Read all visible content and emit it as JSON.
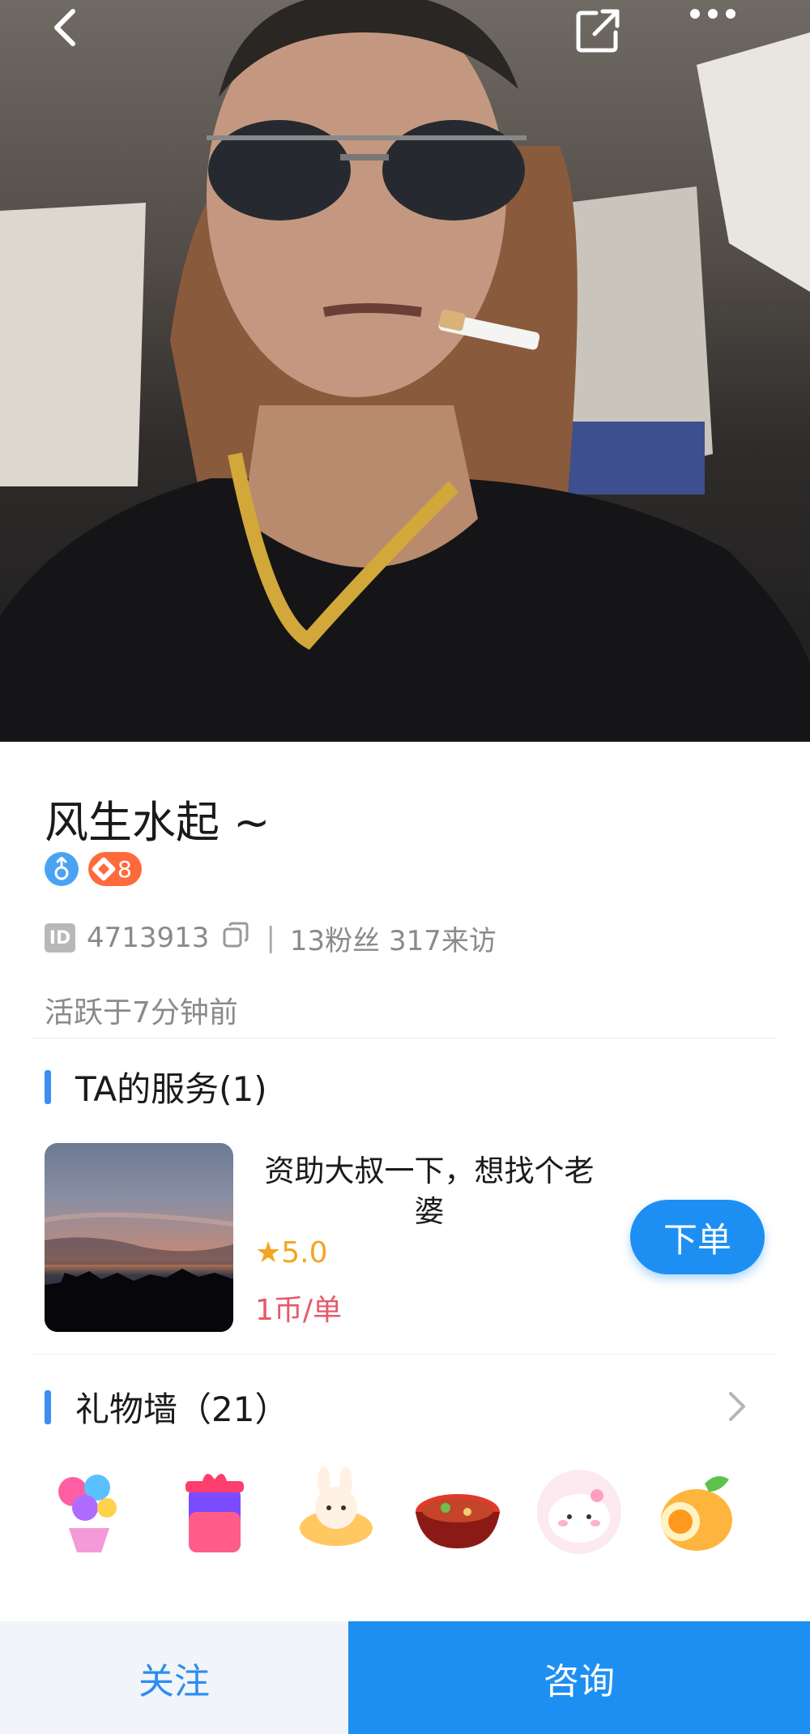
{
  "header": {
    "back_icon": "chevron-left-icon",
    "share_icon": "share-icon",
    "more_icon": "more-dots-icon"
  },
  "profile": {
    "name": "风生水起 ~",
    "gender_icon": "male-icon",
    "level": "8",
    "id_label": "ID",
    "id_value": "4713913",
    "stats": "13粉丝 317来访",
    "separator": "|",
    "active_status": "活跃于7分钟前"
  },
  "services": {
    "title": "TA的服务(1)",
    "items": [
      {
        "title": "资助大叔一下，想找个老婆",
        "rating": "5.0",
        "price": "1币/单",
        "order_label": "下单"
      }
    ]
  },
  "gift_wall": {
    "title": "礼物墙（21）",
    "gifts": [
      "balloon-gift-icon",
      "gift-jar-icon",
      "plush-bunny-icon",
      "hotpot-bowl-icon",
      "dumpling-icon",
      "orange-roll-icon"
    ]
  },
  "bottom_bar": {
    "follow_label": "关注",
    "consult_label": "咨询"
  },
  "colors": {
    "accent": "#1e8ff2",
    "price": "#e8596a",
    "rating": "#f3a521",
    "level_badge": "#ff6a3d"
  }
}
